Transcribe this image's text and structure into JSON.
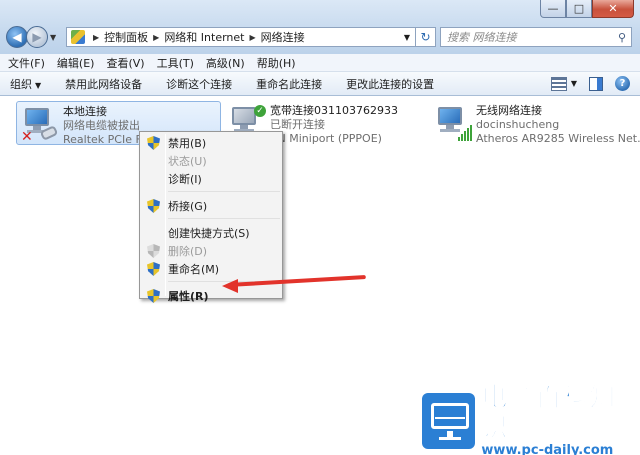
{
  "window": {
    "caption_buttons": {
      "minimize": "—",
      "maximize": "□",
      "close": "✕"
    }
  },
  "address": {
    "crumbs": [
      "控制面板",
      "网络和 Internet",
      "网络连接"
    ]
  },
  "search": {
    "placeholder": "搜索 网络连接"
  },
  "menubar": {
    "items": [
      "文件(F)",
      "编辑(E)",
      "查看(V)",
      "工具(T)",
      "高级(N)",
      "帮助(H)"
    ]
  },
  "toolbar": {
    "organize": "组织",
    "disable": "禁用此网络设备",
    "diagnose": "诊断这个连接",
    "rename": "重命名此连接",
    "change_settings": "更改此连接的设置"
  },
  "connections": [
    {
      "name": "本地连接",
      "status": "网络电缆被拔出",
      "device": "Realtek PCIe FE"
    },
    {
      "name": "宽带连接031103762933",
      "status": "已断开连接",
      "device": "AN Miniport (PPPOE)"
    },
    {
      "name": "无线网络连接",
      "status": "docinshucheng",
      "device": "Atheros AR9285 Wireless Net..."
    }
  ],
  "context_menu": {
    "items": [
      {
        "label": "禁用(B)",
        "shield": true,
        "disabled": false,
        "bold": false
      },
      {
        "label": "状态(U)",
        "shield": false,
        "disabled": true,
        "bold": false
      },
      {
        "label": "诊断(I)",
        "shield": false,
        "disabled": false,
        "bold": false
      },
      {
        "label": "桥接(G)",
        "shield": true,
        "disabled": false,
        "bold": false
      },
      {
        "label": "创建快捷方式(S)",
        "shield": false,
        "disabled": false,
        "bold": false
      },
      {
        "label": "删除(D)",
        "shield": true,
        "disabled": true,
        "bold": false
      },
      {
        "label": "重命名(M)",
        "shield": true,
        "disabled": false,
        "bold": false
      },
      {
        "label": "属性(R)",
        "shield": true,
        "disabled": false,
        "bold": true
      }
    ]
  },
  "watermark": {
    "title": "电脑百科知识",
    "url": "www.pc-daily.com"
  },
  "colors": {
    "accent": "#2b7fd4",
    "arrow": "#e2332b",
    "selection": "#d3e5fa"
  }
}
